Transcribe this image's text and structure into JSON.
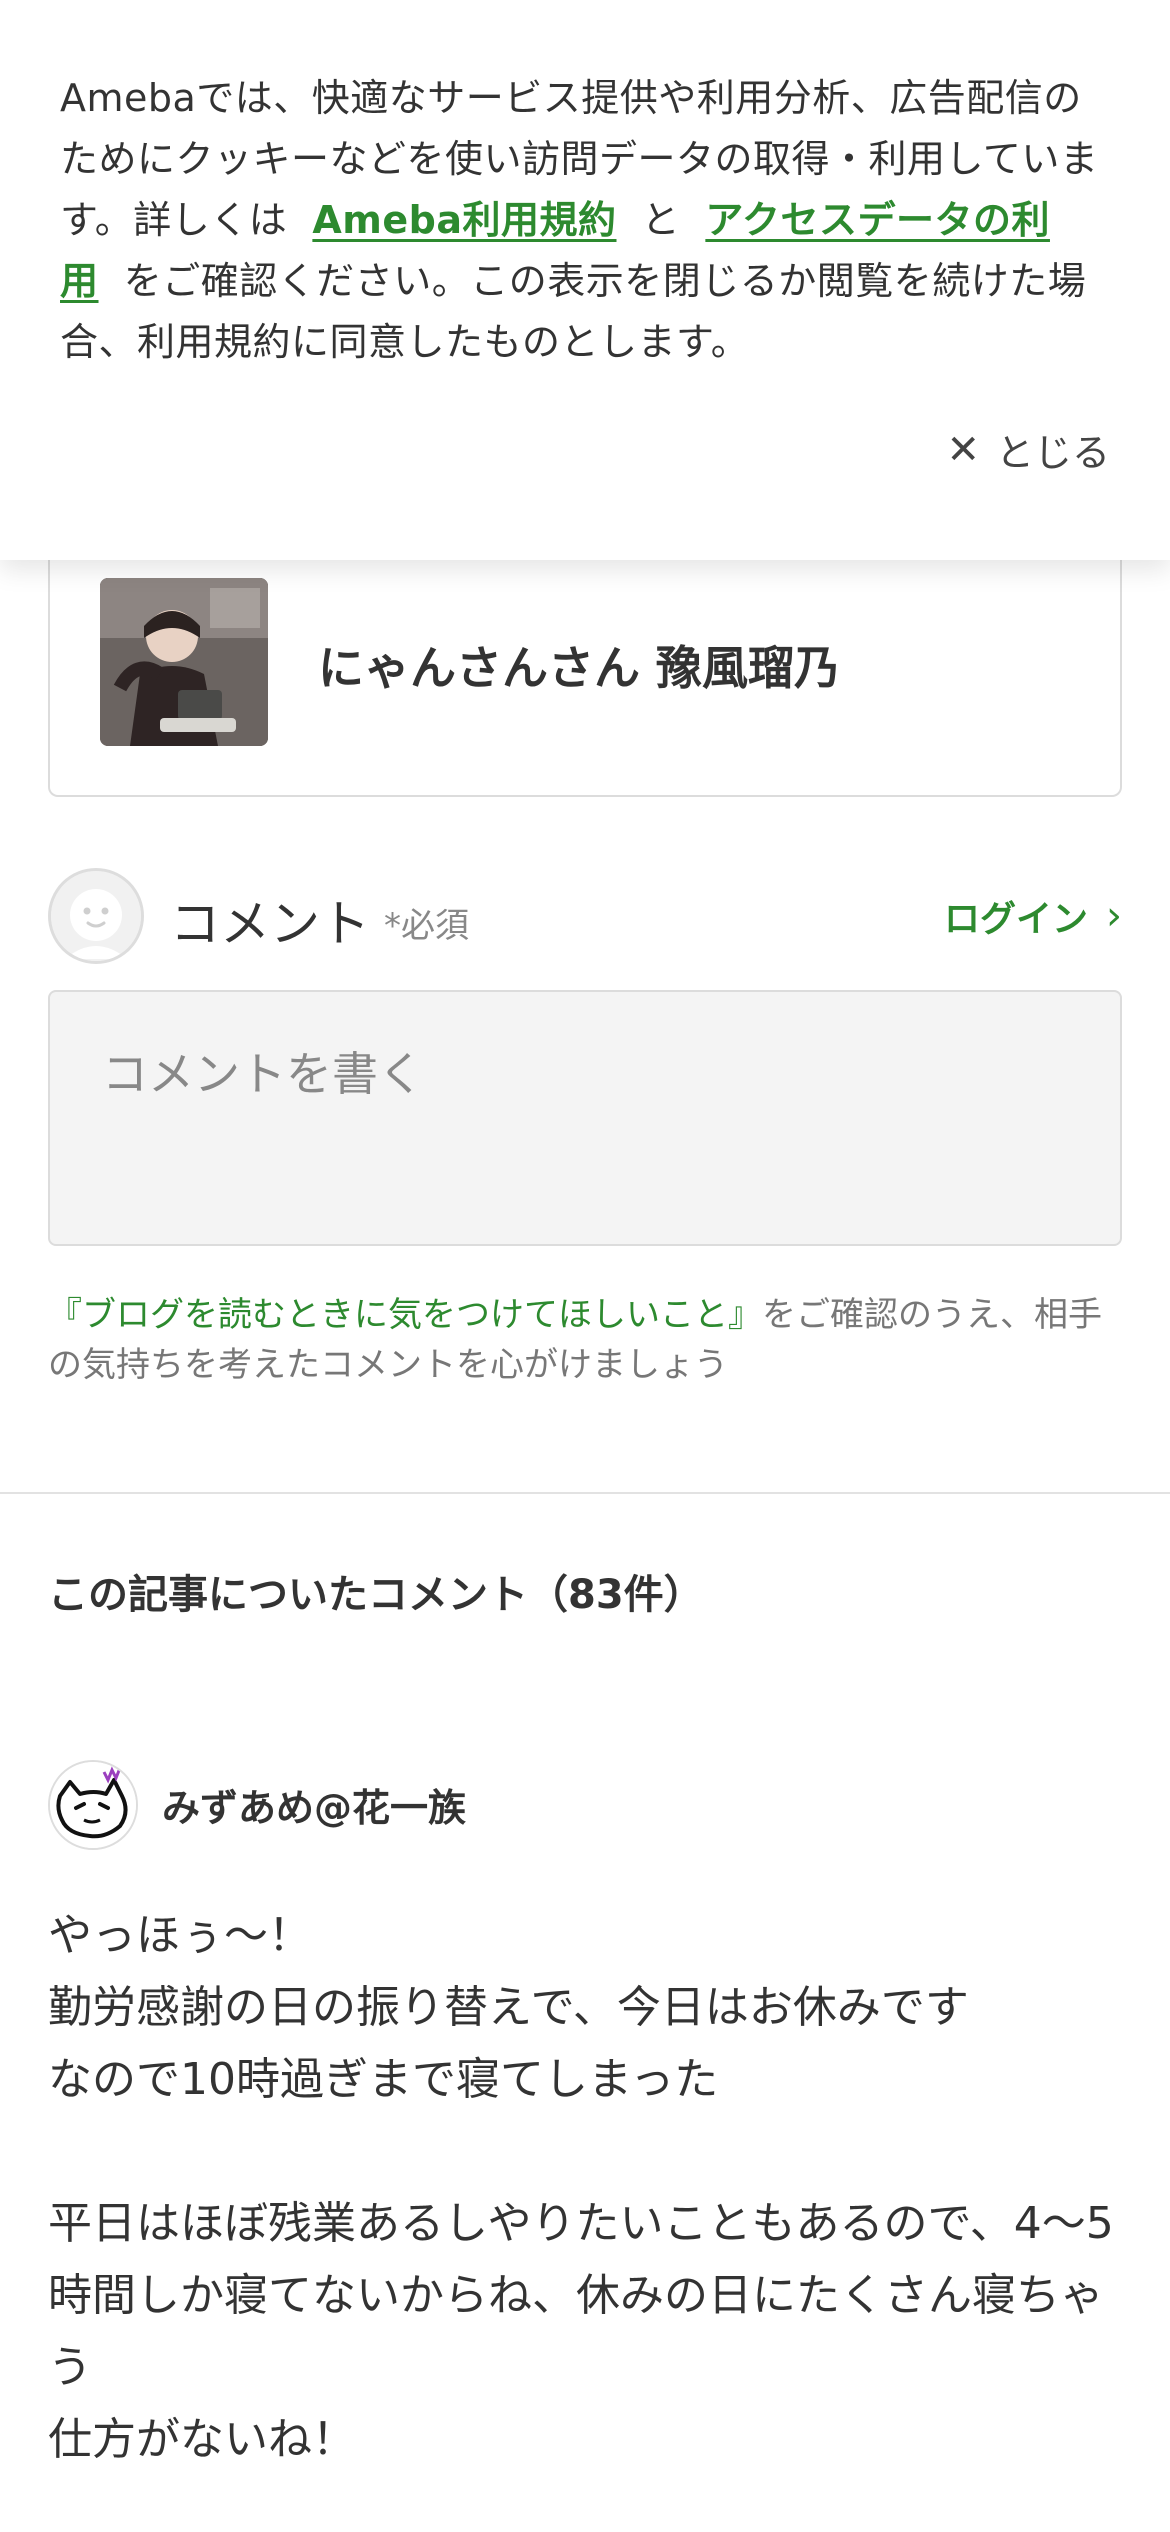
{
  "cookie_banner": {
    "text_before": "Amebaでは、快適なサービス提供や利用分析、広告配信のためにクッキーなどを使い訪問データの取得・利用しています。詳しくは",
    "link1": "Ameba利用規約",
    "connector": "と",
    "link2": "アクセスデータの利用",
    "text_after": "をご確認ください。この表示を閉じるか閲覧を続けた場合、利用規約に同意したものとします。",
    "close_label": "とじる",
    "close_icon": "close-icon"
  },
  "author_card": {
    "name": "にゃんさんさん 豫風瑠乃"
  },
  "comment_form": {
    "title": "コメント",
    "required": "*必須",
    "login_label": "ログイン",
    "placeholder": "コメントを書く",
    "guideline_link": "『ブログを読むときに気をつけてほしいこと』",
    "guideline_text": "をご確認のうえ、相手の気持ちを考えたコメントを心がけましょう"
  },
  "comments": {
    "heading": "この記事についたコメント（83件）",
    "items": [
      {
        "author": "みずあめ@花一族",
        "body": "やっほぅ～！\n勤労感謝の日の振り替えで、今日はお休みです\nなので10時過ぎまで寝てしまった\n\n平日はほぼ残業あるしやりたいこともあるので、4～5時間しか寝てないからね、休みの日にたくさん寝ちゃう\n仕方がないね！"
      }
    ]
  },
  "colors": {
    "accent": "#2d8a2f",
    "text": "#333333",
    "muted": "#777777",
    "border": "#dcdcdc"
  }
}
